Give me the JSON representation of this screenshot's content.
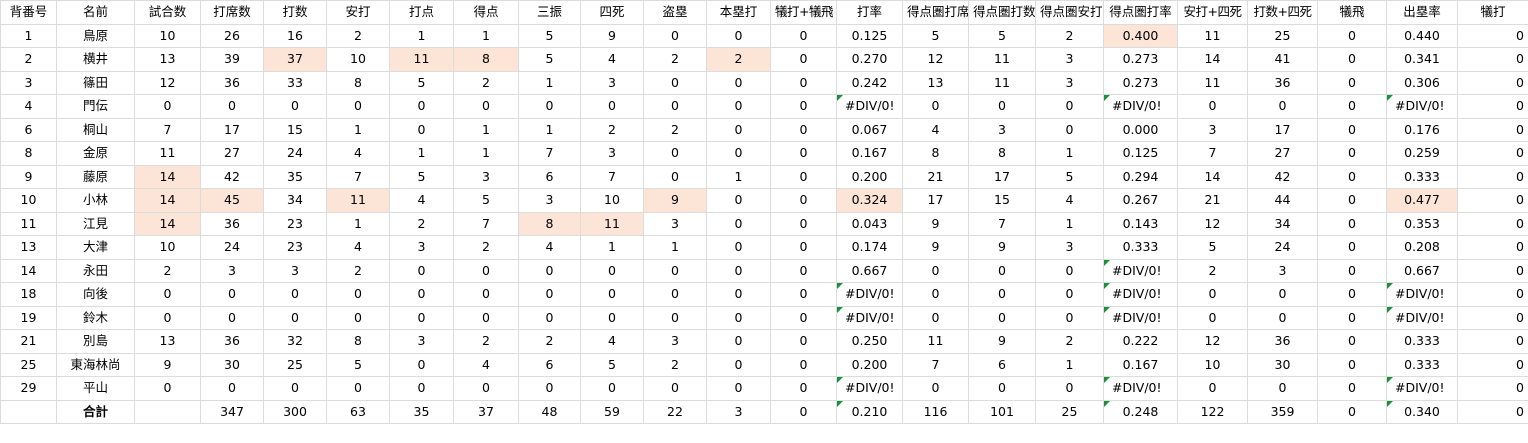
{
  "headers": [
    "背番号",
    "名前",
    "試合数",
    "打席数",
    "打数",
    "安打",
    "打点",
    "得点",
    "三振",
    "四死",
    "盗塁",
    "本塁打",
    "犠打+犠飛",
    "打率",
    "得点圏打席",
    "得点圏打数",
    "得点圏安打",
    "得点圏打率",
    "安打+四死",
    "打数+四死",
    "犠飛",
    "出塁率",
    "犠打"
  ],
  "rows": [
    [
      "1",
      "鳥原",
      "10",
      "26",
      "16",
      "2",
      "1",
      "1",
      "5",
      "9",
      "0",
      "0",
      "0",
      "0.125",
      "5",
      "5",
      "2",
      "0.400",
      "11",
      "25",
      "0",
      "0.440",
      "0"
    ],
    [
      "2",
      "横井",
      "13",
      "39",
      "37",
      "10",
      "11",
      "8",
      "5",
      "4",
      "2",
      "2",
      "0",
      "0.270",
      "12",
      "11",
      "3",
      "0.273",
      "14",
      "41",
      "0",
      "0.341",
      "0"
    ],
    [
      "3",
      "篠田",
      "12",
      "36",
      "33",
      "8",
      "5",
      "2",
      "1",
      "3",
      "0",
      "0",
      "0",
      "0.242",
      "13",
      "11",
      "3",
      "0.273",
      "11",
      "36",
      "0",
      "0.306",
      "0"
    ],
    [
      "4",
      "門伝",
      "0",
      "0",
      "0",
      "0",
      "0",
      "0",
      "0",
      "0",
      "0",
      "0",
      "0",
      "#DIV/0!",
      "0",
      "0",
      "0",
      "#DIV/0!",
      "0",
      "0",
      "0",
      "#DIV/0!",
      "0"
    ],
    [
      "6",
      "桐山",
      "7",
      "17",
      "15",
      "1",
      "0",
      "1",
      "1",
      "2",
      "2",
      "0",
      "0",
      "0.067",
      "4",
      "3",
      "0",
      "0.000",
      "3",
      "17",
      "0",
      "0.176",
      "0"
    ],
    [
      "8",
      "金原",
      "11",
      "27",
      "24",
      "4",
      "1",
      "1",
      "7",
      "3",
      "0",
      "0",
      "0",
      "0.167",
      "8",
      "8",
      "1",
      "0.125",
      "7",
      "27",
      "0",
      "0.259",
      "0"
    ],
    [
      "9",
      "藤原",
      "14",
      "42",
      "35",
      "7",
      "5",
      "3",
      "6",
      "7",
      "0",
      "1",
      "0",
      "0.200",
      "21",
      "17",
      "5",
      "0.294",
      "14",
      "42",
      "0",
      "0.333",
      "0"
    ],
    [
      "10",
      "小林",
      "14",
      "45",
      "34",
      "11",
      "4",
      "5",
      "3",
      "10",
      "9",
      "0",
      "0",
      "0.324",
      "17",
      "15",
      "4",
      "0.267",
      "21",
      "44",
      "0",
      "0.477",
      "0"
    ],
    [
      "11",
      "江見",
      "14",
      "36",
      "23",
      "1",
      "2",
      "7",
      "8",
      "11",
      "3",
      "0",
      "0",
      "0.043",
      "9",
      "7",
      "1",
      "0.143",
      "12",
      "34",
      "0",
      "0.353",
      "0"
    ],
    [
      "13",
      "大津",
      "10",
      "24",
      "23",
      "4",
      "3",
      "2",
      "4",
      "1",
      "1",
      "0",
      "0",
      "0.174",
      "9",
      "9",
      "3",
      "0.333",
      "5",
      "24",
      "0",
      "0.208",
      "0"
    ],
    [
      "14",
      "永田",
      "2",
      "3",
      "3",
      "2",
      "0",
      "0",
      "0",
      "0",
      "0",
      "0",
      "0",
      "0.667",
      "0",
      "0",
      "0",
      "#DIV/0!",
      "2",
      "3",
      "0",
      "0.667",
      "0"
    ],
    [
      "18",
      "向後",
      "0",
      "0",
      "0",
      "0",
      "0",
      "0",
      "0",
      "0",
      "0",
      "0",
      "0",
      "#DIV/0!",
      "0",
      "0",
      "0",
      "#DIV/0!",
      "0",
      "0",
      "0",
      "#DIV/0!",
      "0"
    ],
    [
      "19",
      "鈴木",
      "0",
      "0",
      "0",
      "0",
      "0",
      "0",
      "0",
      "0",
      "0",
      "0",
      "0",
      "#DIV/0!",
      "0",
      "0",
      "0",
      "#DIV/0!",
      "0",
      "0",
      "0",
      "#DIV/0!",
      "0"
    ],
    [
      "21",
      "別島",
      "13",
      "36",
      "32",
      "8",
      "3",
      "2",
      "2",
      "4",
      "3",
      "0",
      "0",
      "0.250",
      "11",
      "9",
      "2",
      "0.222",
      "12",
      "36",
      "0",
      "0.333",
      "0"
    ],
    [
      "25",
      "東海林尚",
      "9",
      "30",
      "25",
      "5",
      "0",
      "4",
      "6",
      "5",
      "2",
      "0",
      "0",
      "0.200",
      "7",
      "6",
      "1",
      "0.167",
      "10",
      "30",
      "0",
      "0.333",
      "0"
    ],
    [
      "29",
      "平山",
      "0",
      "0",
      "0",
      "0",
      "0",
      "0",
      "0",
      "0",
      "0",
      "0",
      "0",
      "#DIV/0!",
      "0",
      "0",
      "0",
      "#DIV/0!",
      "0",
      "0",
      "0",
      "#DIV/0!",
      "0"
    ]
  ],
  "total": [
    "",
    "合計",
    "",
    "347",
    "300",
    "63",
    "35",
    "37",
    "48",
    "59",
    "22",
    "3",
    "0",
    "0.210",
    "116",
    "101",
    "25",
    "0.248",
    "122",
    "359",
    "0",
    "0.340",
    "0"
  ],
  "highlights": [
    [
      0,
      17
    ],
    [
      1,
      4
    ],
    [
      1,
      6
    ],
    [
      1,
      7
    ],
    [
      1,
      11
    ],
    [
      6,
      2
    ],
    [
      7,
      2
    ],
    [
      7,
      3
    ],
    [
      7,
      5
    ],
    [
      7,
      10
    ],
    [
      7,
      13
    ],
    [
      7,
      21
    ],
    [
      8,
      2
    ],
    [
      8,
      8
    ],
    [
      8,
      9
    ]
  ],
  "highlight_color": "#fce4d6",
  "error_marker_color": "#1a8f3c"
}
